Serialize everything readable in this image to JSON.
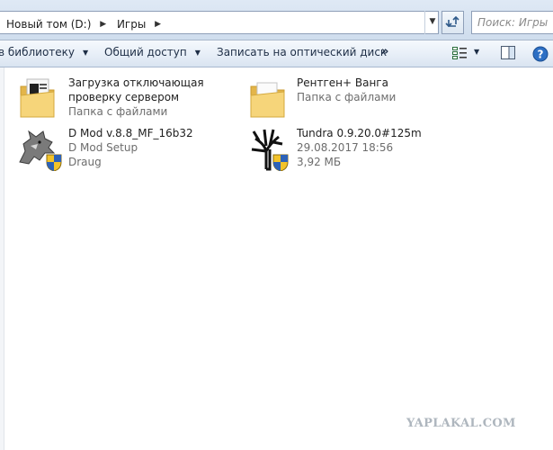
{
  "address": {
    "crumbs": [
      "Новый том (D:)",
      "Игры"
    ],
    "search_placeholder": "Поиск: Игры"
  },
  "toolbar": {
    "library_label": "в библиотеку",
    "share_label": "Общий доступ",
    "burn_label": "Записать на оптический диск",
    "more_label": "»"
  },
  "items": [
    {
      "name": "Загрузка отключающая проверку сервером",
      "sub1": "Папка с файлами",
      "sub2": "",
      "icon": "folder-documents-icon"
    },
    {
      "name": "Рентген+ Ванга",
      "sub1": "Папка с файлами",
      "sub2": "",
      "icon": "folder-icon"
    },
    {
      "name": "D Mod v.8.8_MF_16b32",
      "sub1": "D Mod Setup",
      "sub2": "Draug",
      "icon": "wolf-setup-icon"
    },
    {
      "name": "Tundra 0.9.20.0#125m",
      "sub1": "29.08.2017 18:56",
      "sub2": "3,92 МБ",
      "icon": "tree-setup-icon"
    }
  ],
  "watermark": "YAPLAKAL.COM",
  "colors": {
    "toolbar_text": "#1e2e46",
    "secondary_text": "#6d6d6d",
    "folder": "#f1c75e"
  }
}
